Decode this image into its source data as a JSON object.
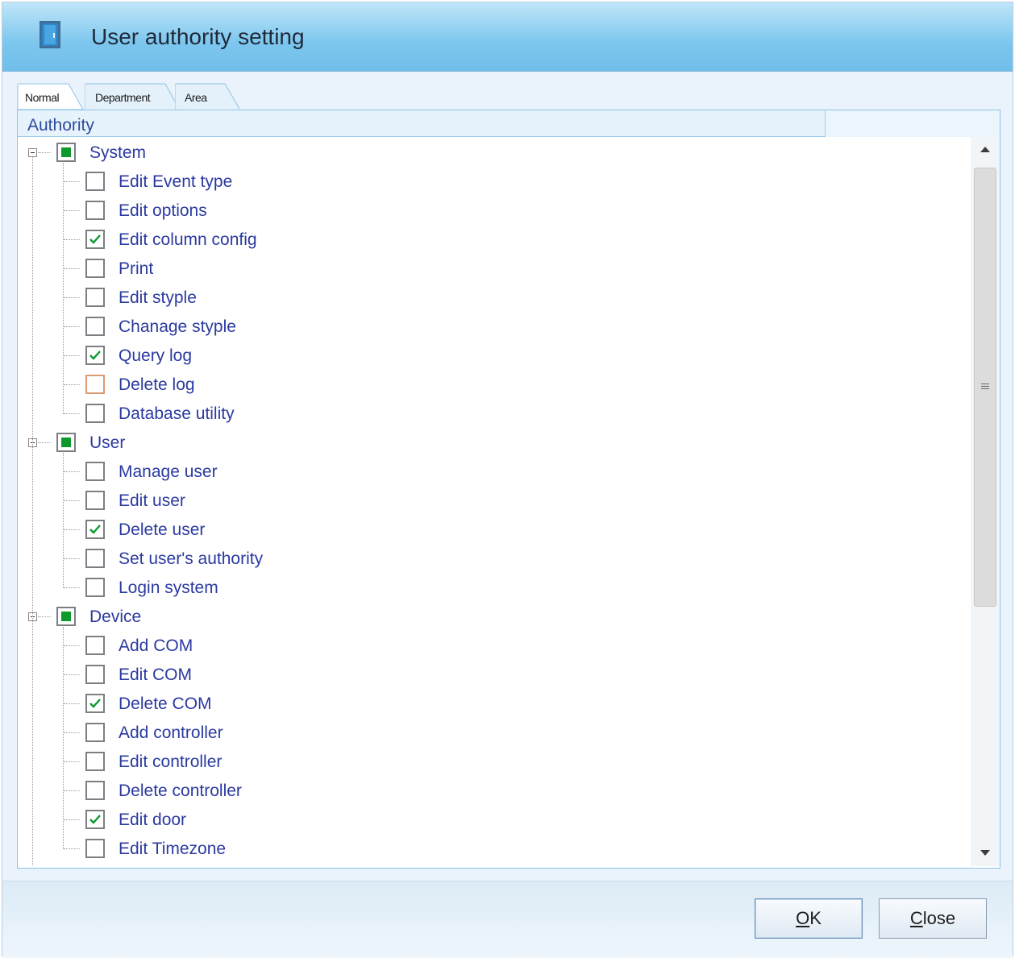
{
  "window": {
    "title": "User authority setting",
    "icon": "door-icon"
  },
  "tabs": [
    {
      "label": "Normal",
      "active": true
    },
    {
      "label": "Department",
      "active": false
    },
    {
      "label": "Area",
      "active": false
    }
  ],
  "tree": {
    "column_header": "Authority",
    "groups": [
      {
        "label": "System",
        "expanded": true,
        "state": "partial",
        "items": [
          {
            "label": "Edit Event type",
            "checked": false
          },
          {
            "label": "Edit options",
            "checked": false
          },
          {
            "label": "Edit column config",
            "checked": true
          },
          {
            "label": "Print",
            "checked": false
          },
          {
            "label": "Edit styple",
            "checked": false
          },
          {
            "label": "Chanage styple",
            "checked": false
          },
          {
            "label": "Query log",
            "checked": true
          },
          {
            "label": "Delete log",
            "checked": false,
            "hover": true
          },
          {
            "label": "Database utility",
            "checked": false
          }
        ]
      },
      {
        "label": "User",
        "expanded": true,
        "state": "partial",
        "items": [
          {
            "label": "Manage user",
            "checked": false
          },
          {
            "label": "Edit user",
            "checked": false
          },
          {
            "label": "Delete user",
            "checked": true
          },
          {
            "label": "Set user's authority",
            "checked": false
          },
          {
            "label": "Login system",
            "checked": false
          }
        ]
      },
      {
        "label": "Device",
        "expanded": true,
        "state": "partial",
        "items": [
          {
            "label": "Add COM",
            "checked": false
          },
          {
            "label": "Edit COM",
            "checked": false
          },
          {
            "label": "Delete COM",
            "checked": true
          },
          {
            "label": "Add controller",
            "checked": false
          },
          {
            "label": "Edit controller",
            "checked": false
          },
          {
            "label": "Delete controller",
            "checked": false
          },
          {
            "label": "Edit door",
            "checked": true
          },
          {
            "label": "Edit Timezone",
            "checked": false
          }
        ]
      }
    ]
  },
  "buttons": {
    "ok": {
      "label": "OK",
      "mnemonic": "O",
      "rest": "K"
    },
    "close": {
      "label": "Close",
      "mnemonic": "C",
      "rest": "lose"
    }
  },
  "colors": {
    "title_bar": "#7cc6ee",
    "tree_text": "#2b3aa0",
    "check_green": "#0e9a2b",
    "panel_border": "#8fc3e6"
  }
}
